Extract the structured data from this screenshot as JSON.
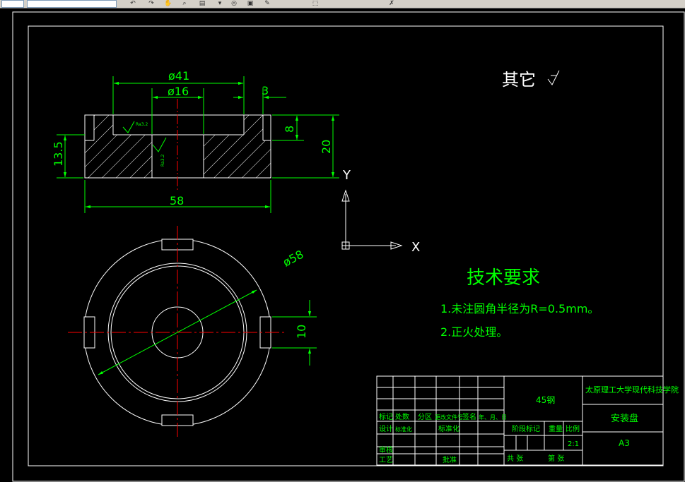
{
  "toolbar": {
    "icons": [
      "undo-icon",
      "redo-icon",
      "pan-icon",
      "zoom-icon",
      "layer-icon",
      "properties-icon",
      "copy-icon",
      "paste-icon",
      "draw-icon",
      "select-icon",
      "erase-icon"
    ]
  },
  "drawing": {
    "other_note": "其它",
    "dim_d41": "ø41",
    "dim_d16": "ø16",
    "dim_3": "3",
    "dim_8": "8",
    "dim_20": "20",
    "dim_13_5": "13.5",
    "dim_58_len": "58",
    "dim_d58": "ø58",
    "dim_10": "10",
    "roughness_1": "Ra3.2",
    "roughness_2": "Ra3.2",
    "ucs_y": "Y",
    "ucs_x": "X",
    "tech_title": "技术要求",
    "tech_note_1": "1.未注圆角半径为R=0.5mm。",
    "tech_note_2": "2.正火处理。"
  },
  "title_block": {
    "material": "45钢",
    "school": "太原理工大学现代科技学院",
    "part_name": "安装盘",
    "sheet_size": "A3",
    "scale": "2:1",
    "col_mark": "标记",
    "col_count": "处数",
    "col_zone": "分区",
    "col_docno": "更改文件号",
    "col_sign": "签名",
    "col_date": "年、月、日",
    "design": "设计",
    "standardize": "标准化",
    "std_label": "标准化",
    "check": "审核",
    "process": "工艺",
    "approve": "批准",
    "stage_mark": "阶段标记",
    "weight": "重量",
    "ratio": "比例",
    "total_sheets": "共 张",
    "sheet_no": "第 张"
  }
}
